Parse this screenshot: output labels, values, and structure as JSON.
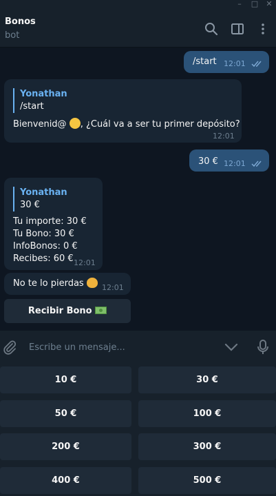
{
  "window": {
    "minimize": "–",
    "maximize": "□",
    "close": "✕"
  },
  "header": {
    "title": "Bonos",
    "subtitle": "bot",
    "icons": [
      "search-icon",
      "sidebar-icon",
      "more-vertical-icon"
    ]
  },
  "messages": [
    {
      "type": "out",
      "text": "/start",
      "time": "12:01"
    },
    {
      "type": "in",
      "reply_name": "Yonathan",
      "reply_text": "/start",
      "text_before": "Bienvenid@",
      "emoji": "hugging-face",
      "text_after": ", ¿Cuál va a ser tu primer depósito?",
      "time": "12:01"
    },
    {
      "type": "out",
      "text": "30 €",
      "time": "12:01"
    },
    {
      "type": "in",
      "reply_name": "Yonathan",
      "reply_text": "30 €",
      "lines": [
        "Tu importe: 30 €",
        "Tu Bono: 30 €",
        "InfoBonos: 0 €",
        "Recibes: 60 €"
      ],
      "time": "12:01"
    },
    {
      "type": "in",
      "text": "No te lo pierdas",
      "emoji": "smirking-cat",
      "time": "12:01"
    }
  ],
  "inline_button": {
    "label": "Recibir Bono",
    "emoji": "money-banknote"
  },
  "composer": {
    "placeholder": "Escribe un mensaje...",
    "icons": [
      "attach-icon",
      "chevron-down-icon",
      "microphone-icon"
    ]
  },
  "keyboard": {
    "buttons": [
      "10 €",
      "30 €",
      "50 €",
      "100 €",
      "200 €",
      "300 €",
      "400 €",
      "500 €"
    ]
  },
  "colors": {
    "background": "#0e1621",
    "header": "#17212b",
    "outgoing": "#2b5278",
    "incoming": "#182533",
    "accent": "#6ab2f2"
  }
}
